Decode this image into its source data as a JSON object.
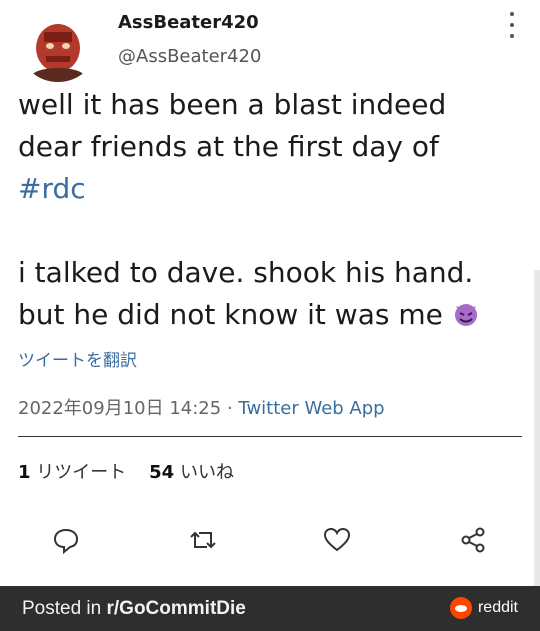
{
  "tweet": {
    "display_name": "AssBeater420",
    "handle": "@AssBeater420",
    "text_line1": "well it has been a blast indeed",
    "text_line2": "dear friends at the first day of",
    "hashtag": "#rdc",
    "text_line4": "i talked to dave. shook his hand.",
    "text_line5": "but he did not know it was me",
    "translate_label": "ツイートを翻訳",
    "timestamp": "2022年09月10日 14:25",
    "separator": "·",
    "source_app": "Twitter Web App",
    "retweet_count": "1",
    "retweet_label": "リツイート",
    "like_count": "54",
    "like_label": "いいね"
  },
  "icons": {
    "reply": "reply-icon",
    "retweet": "retweet-icon",
    "like": "heart-icon",
    "share": "share-icon",
    "more": "more-vertical-icon",
    "emoji": "smiling-devil-emoji"
  },
  "footer": {
    "posted_prefix": "Posted in ",
    "subreddit": "r/GoCommitDie",
    "brand": "reddit"
  },
  "colors": {
    "link": "#3b6ea0",
    "footer_bg": "#2e2e2e",
    "reddit_orange": "#ff4500",
    "devil_purple": "#9b59b6"
  }
}
